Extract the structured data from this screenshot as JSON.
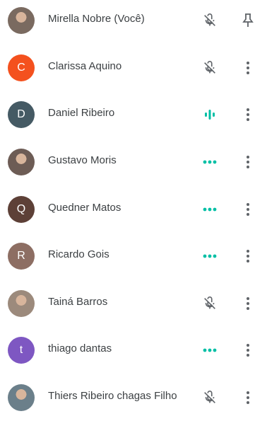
{
  "accent": "#00bfa5",
  "muted_icon_color": "#5f6368",
  "participants": [
    {
      "name": "Mirella Nobre (Você)",
      "initial": "",
      "avatar": "photo",
      "avatar_color": "#7a6a60",
      "status": "muted",
      "action": "pin-icon"
    },
    {
      "name": "Clarissa Aquino",
      "initial": "C",
      "avatar": "initial",
      "avatar_color": "#f4511e",
      "status": "muted",
      "action": "more-vert-icon"
    },
    {
      "name": "Daniel Ribeiro",
      "initial": "D",
      "avatar": "initial",
      "avatar_color": "#455a64",
      "status": "speaking",
      "action": "more-vert-icon"
    },
    {
      "name": "Gustavo Moris",
      "initial": "",
      "avatar": "photo",
      "avatar_color": "#6d5c55",
      "status": "unmuted",
      "action": "more-vert-icon"
    },
    {
      "name": "Quedner Matos",
      "initial": "Q",
      "avatar": "initial",
      "avatar_color": "#5d4037",
      "status": "unmuted",
      "action": "more-vert-icon"
    },
    {
      "name": "Ricardo Gois",
      "initial": "R",
      "avatar": "initial",
      "avatar_color": "#8d6e63",
      "status": "unmuted",
      "action": "more-vert-icon"
    },
    {
      "name": "Tainá Barros",
      "initial": "",
      "avatar": "photo",
      "avatar_color": "#9c8a7c",
      "status": "muted",
      "action": "more-vert-icon"
    },
    {
      "name": "thiago dantas",
      "initial": "t",
      "avatar": "initial",
      "avatar_color": "#7e57c2",
      "status": "unmuted",
      "action": "more-vert-icon"
    },
    {
      "name": "Thiers Ribeiro chagas Filho",
      "initial": "",
      "avatar": "photo",
      "avatar_color": "#6b7f8a",
      "status": "muted",
      "action": "more-vert-icon"
    }
  ]
}
